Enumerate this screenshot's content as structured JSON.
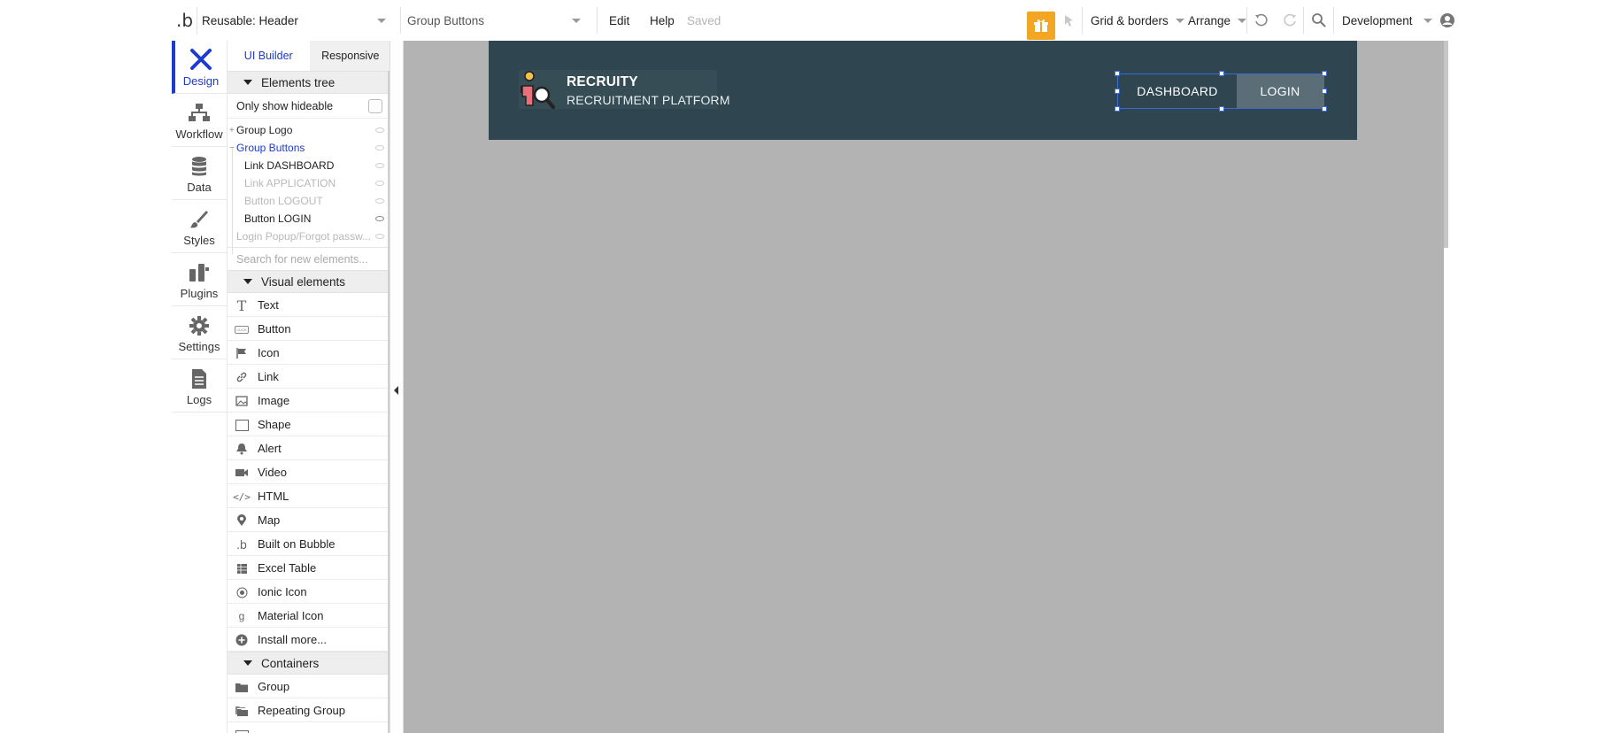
{
  "topbar": {
    "page_selector": "Reusable: Header",
    "element_selector": "Group Buttons",
    "menu_edit": "Edit",
    "menu_help": "Help",
    "status": "Saved",
    "grid_borders": "Grid & borders",
    "arrange": "Arrange",
    "environment": "Development",
    "gift_color": "#f2a623"
  },
  "leftnav": {
    "items": [
      {
        "label": "Design"
      },
      {
        "label": "Workflow"
      },
      {
        "label": "Data"
      },
      {
        "label": "Styles"
      },
      {
        "label": "Plugins"
      },
      {
        "label": "Settings"
      },
      {
        "label": "Logs"
      }
    ]
  },
  "panel": {
    "tabs": [
      "UI Builder",
      "Responsive"
    ],
    "elements_tree_title": "Elements tree",
    "only_show_hideable": "Only show hideable",
    "tree": [
      "Group Logo",
      "Group Buttons",
      "Link DASHBOARD",
      "Link APPLICATION",
      "Button LOGOUT",
      "Button LOGIN",
      "Login Popup/Forgot passw..."
    ],
    "search_placeholder": "Search for new elements...",
    "visual_title": "Visual elements",
    "visual": [
      "Text",
      "Button",
      "Icon",
      "Link",
      "Image",
      "Shape",
      "Alert",
      "Video",
      "HTML",
      "Map",
      "Built on Bubble",
      "Excel Table",
      "Ionic Icon",
      "Material Icon",
      "Install more..."
    ],
    "containers_title": "Containers",
    "containers": [
      "Group",
      "Repeating Group"
    ],
    "accent_color": "#1b3bd1"
  },
  "canvas": {
    "header_bg": "#2f4650",
    "logo_title": "RECRUITY",
    "logo_subtitle": "RECRUITMENT PLATFORM",
    "btn_dashboard": "DASHBOARD",
    "btn_login": "LOGIN"
  }
}
